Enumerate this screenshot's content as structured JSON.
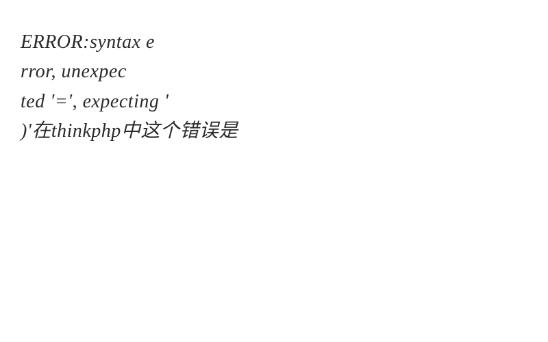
{
  "error": {
    "prefix": "ERROR:syntax e",
    "segments": [
      "rror, unexpec",
      "ted '=', expecting '",
      ")'在thinkphp中这个错误是"
    ]
  }
}
